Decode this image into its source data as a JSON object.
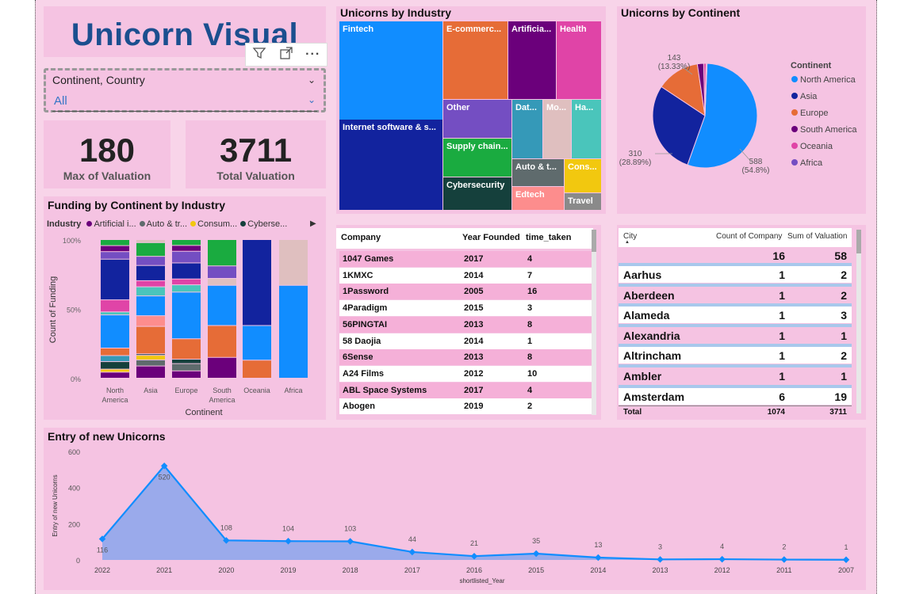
{
  "title": "Unicorn Visual",
  "visual_header": {
    "filter_icon": "filter-icon",
    "focus_icon": "focus-mode-icon",
    "more_icon": "more-options-icon"
  },
  "slicer": {
    "label": "Continent, Country",
    "value": "All"
  },
  "kpis": [
    {
      "value": "180",
      "caption": "Max of Valuation"
    },
    {
      "value": "3711",
      "caption": "Total Valuation"
    }
  ],
  "treemap": {
    "title": "Unicorns by Industry",
    "tiles": [
      {
        "label": "Fintech",
        "color": "#118dff"
      },
      {
        "label": "Internet software & s...",
        "color": "#12239e"
      },
      {
        "label": "E-commerc...",
        "color": "#e66c37"
      },
      {
        "label": "Artificia...",
        "color": "#6b007b"
      },
      {
        "label": "Health",
        "color": "#e044a7"
      },
      {
        "label": "Other",
        "color": "#744ec2"
      },
      {
        "label": "Dat...",
        "color": "#3599b8"
      },
      {
        "label": "Mo...",
        "color": "#dfbfbf"
      },
      {
        "label": "Ha...",
        "color": "#4ac5bb"
      },
      {
        "label": "Supply chain...",
        "color": "#1aab40"
      },
      {
        "label": "Auto & t...",
        "color": "#5f6b6d"
      },
      {
        "label": "Cons...",
        "color": "#f2c80f"
      },
      {
        "label": "Cybersecurity",
        "color": "#15403c"
      },
      {
        "label": "Edtech",
        "color": "#fd8d8d"
      },
      {
        "label": "Travel",
        "color": "#8a8a8a"
      }
    ]
  },
  "pie": {
    "title": "Unicorns by Continent",
    "legend_title": "Continent",
    "labels": {
      "north_america": "588\n(54.8%)",
      "asia": "310\n(28.89%)",
      "europe": "143\n(13.33%)"
    },
    "chart_data": {
      "type": "pie",
      "slices": [
        {
          "name": "North America",
          "value": 588,
          "color": "#118dff"
        },
        {
          "name": "Asia",
          "value": 310,
          "color": "#12239e"
        },
        {
          "name": "Europe",
          "value": 143,
          "color": "#e66c37"
        },
        {
          "name": "South America",
          "value": 21,
          "color": "#6b007b"
        },
        {
          "name": "Oceania",
          "value": 8,
          "color": "#e044a7"
        },
        {
          "name": "Africa",
          "value": 3,
          "color": "#744ec2"
        }
      ]
    }
  },
  "stacked": {
    "title": "Funding by Continent by Industry",
    "legend_label": "Industry",
    "legend_items": [
      {
        "name": "Artificial i...",
        "color": "#6b007b"
      },
      {
        "name": "Auto & tr...",
        "color": "#5f6b6d"
      },
      {
        "name": "Consum...",
        "color": "#f2c80f"
      },
      {
        "name": "Cyberse...",
        "color": "#15403c"
      }
    ],
    "ylabel": "Count of Funding",
    "xlabel": "Continent",
    "yticks": [
      "100%",
      "50%",
      "0%"
    ],
    "categories": [
      "North\nAmerica",
      "Asia",
      "Europe",
      "South\nAmerica",
      "Oceania",
      "Africa"
    ],
    "chart_data": {
      "type": "bar",
      "stacked_percent": true,
      "categories": [
        "North America",
        "Asia",
        "Europe",
        "South America",
        "Oceania",
        "Africa"
      ],
      "columns": [
        [
          {
            "v": 4,
            "c": "#6b007b"
          },
          {
            "v": 2,
            "c": "#f2c80f"
          },
          {
            "v": 5,
            "c": "#15403c"
          },
          {
            "v": 4,
            "c": "#3599b8"
          },
          {
            "v": 5,
            "c": "#e66c37"
          },
          {
            "v": 22,
            "c": "#118dff"
          },
          {
            "v": 2,
            "c": "#4ac5bb"
          },
          {
            "v": 8,
            "c": "#e044a7"
          },
          {
            "v": 27,
            "c": "#12239e"
          },
          {
            "v": 5,
            "c": "#744ec2"
          },
          {
            "v": 4,
            "c": "#6b007b"
          },
          {
            "v": 4,
            "c": "#1aab40"
          }
        ],
        [
          {
            "v": 8,
            "c": "#6b007b"
          },
          {
            "v": 4,
            "c": "#5f6b6d"
          },
          {
            "v": 3,
            "c": "#f2c80f"
          },
          {
            "v": 1,
            "c": "#15403c"
          },
          {
            "v": 18,
            "c": "#e66c37"
          },
          {
            "v": 7,
            "c": "#fd8d8d"
          },
          {
            "v": 13,
            "c": "#118dff"
          },
          {
            "v": 6,
            "c": "#4ac5bb"
          },
          {
            "v": 4,
            "c": "#e044a7"
          },
          {
            "v": 10,
            "c": "#12239e"
          },
          {
            "v": 6,
            "c": "#744ec2"
          },
          {
            "v": 9,
            "c": "#1aab40"
          },
          {
            "v": 2,
            "c": "#dfbfbf"
          }
        ],
        [
          {
            "v": 5,
            "c": "#6b007b"
          },
          {
            "v": 5,
            "c": "#5f6b6d"
          },
          {
            "v": 3,
            "c": "#15403c"
          },
          {
            "v": 14,
            "c": "#e66c37"
          },
          {
            "v": 32,
            "c": "#118dff"
          },
          {
            "v": 5,
            "c": "#4ac5bb"
          },
          {
            "v": 4,
            "c": "#e044a7"
          },
          {
            "v": 11,
            "c": "#12239e"
          },
          {
            "v": 8,
            "c": "#744ec2"
          },
          {
            "v": 4,
            "c": "#6b007b"
          },
          {
            "v": 4,
            "c": "#1aab40"
          }
        ],
        [
          {
            "v": 15,
            "c": "#6b007b"
          },
          {
            "v": 23,
            "c": "#e66c37"
          },
          {
            "v": 29,
            "c": "#118dff"
          },
          {
            "v": 5,
            "c": "#dfbfbf"
          },
          {
            "v": 9,
            "c": "#744ec2"
          },
          {
            "v": 19,
            "c": "#1aab40"
          }
        ],
        [
          {
            "v": 13,
            "c": "#e66c37"
          },
          {
            "v": 25,
            "c": "#118dff"
          },
          {
            "v": 62,
            "c": "#12239e"
          }
        ],
        [
          {
            "v": 67,
            "c": "#118dff"
          },
          {
            "v": 33,
            "c": "#dfbfbf"
          }
        ]
      ]
    }
  },
  "company_table": {
    "headers": [
      "Company",
      "Year Founded",
      "time_taken"
    ],
    "rows": [
      [
        "1047 Games",
        "2017",
        "4"
      ],
      [
        "1KMXC",
        "2014",
        "7"
      ],
      [
        "1Password",
        "2005",
        "16"
      ],
      [
        "4Paradigm",
        "2015",
        "3"
      ],
      [
        "56PINGTAI",
        "2013",
        "8"
      ],
      [
        "58 Daojia",
        "2014",
        "1"
      ],
      [
        "6Sense",
        "2013",
        "8"
      ],
      [
        "A24 Films",
        "2012",
        "10"
      ],
      [
        "ABL Space Systems",
        "2017",
        "4"
      ],
      [
        "Abogen",
        "2019",
        "2"
      ]
    ]
  },
  "city_table": {
    "headers": [
      "City",
      "Count of Company",
      "Sum of Valuation"
    ],
    "blank_row": [
      "16",
      "58"
    ],
    "rows": [
      [
        "Aarhus",
        "1",
        "2"
      ],
      [
        "Aberdeen",
        "1",
        "2"
      ],
      [
        "Alameda",
        "1",
        "3"
      ],
      [
        "Alexandria",
        "1",
        "1"
      ],
      [
        "Altrincham",
        "1",
        "2"
      ],
      [
        "Ambler",
        "1",
        "1"
      ],
      [
        "Amsterdam",
        "6",
        "19"
      ]
    ],
    "total": [
      "Total",
      "1074",
      "3711"
    ]
  },
  "area": {
    "title": "Entry of new Unicorns",
    "ylabel": "Entry of new Unicorns",
    "xlabel": "shortlisted_Year",
    "yticks": [
      "600",
      "400",
      "200",
      "0"
    ],
    "chart_data": {
      "type": "area",
      "x": [
        "2022",
        "2021",
        "2020",
        "2019",
        "2018",
        "2017",
        "2016",
        "2015",
        "2014",
        "2013",
        "2012",
        "2011",
        "2007"
      ],
      "y": [
        116,
        520,
        108,
        104,
        103,
        44,
        21,
        35,
        13,
        3,
        4,
        2,
        1
      ],
      "ylim": [
        0,
        600
      ]
    }
  }
}
